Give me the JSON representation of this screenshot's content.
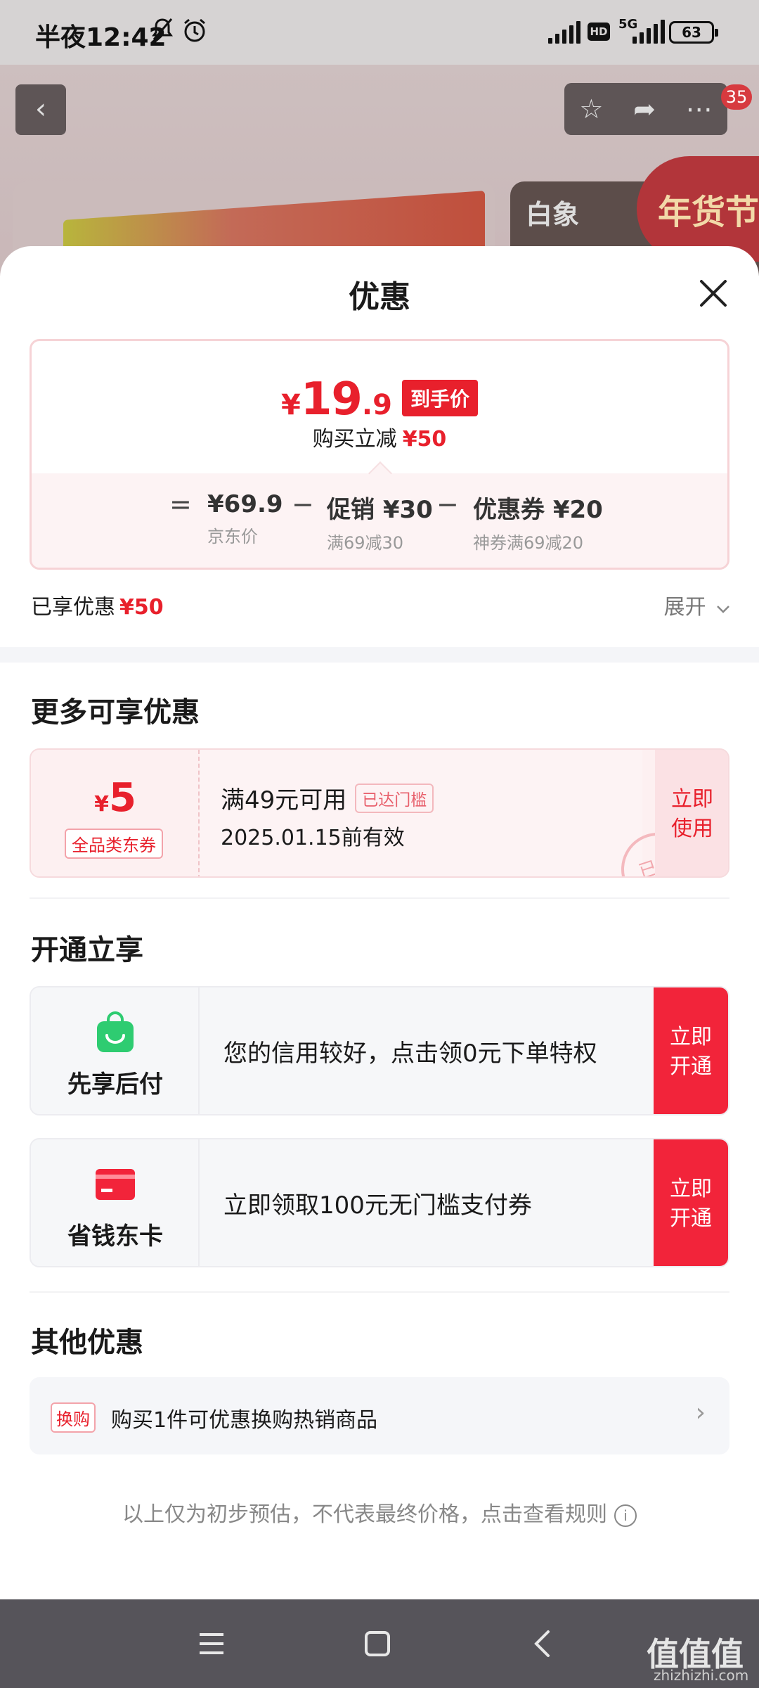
{
  "status_bar": {
    "time": "半夜12:42",
    "network": "5G",
    "hd": "HD",
    "battery": "63"
  },
  "background_page": {
    "cart_badge": "35",
    "brand_logo": "白象",
    "festival_label": "年货节"
  },
  "sheet": {
    "title": "优惠",
    "price": {
      "currency": "¥",
      "integer": "19",
      "decimal": ".9",
      "tag": "到手价",
      "reduce_label": "购买立减",
      "reduce_value": "¥50"
    },
    "breakdown": {
      "equals": "=",
      "items": [
        {
          "value": "¥69.9",
          "label": "京东价"
        },
        {
          "value": "促销 ¥30",
          "label": "满69减30"
        },
        {
          "value": "优惠券 ¥20",
          "label": "神券满69减20"
        }
      ],
      "minus": "−"
    },
    "enjoyed": {
      "label": "已享优惠",
      "value": "¥50"
    },
    "expand": "展开"
  },
  "more_offers": {
    "title": "更多可享优惠",
    "coupon": {
      "currency": "¥",
      "amount": "5",
      "type": "全品类东券",
      "condition": "满49元可用",
      "reached": "已达门槛",
      "expiry": "2025.01.15前有效",
      "stamp": "已领",
      "action": "立即使用"
    }
  },
  "open_section": {
    "title": "开通立享",
    "services": [
      {
        "name": "先享后付",
        "text": "您的信用较好，点击领0元下单特权",
        "action": "立即开通"
      },
      {
        "name": "省钱东卡",
        "text": "立即领取100元无门槛支付券",
        "action": "立即开通"
      }
    ]
  },
  "other_section": {
    "title": "其他优惠",
    "tag": "换购",
    "text": "购买1件可优惠换购热销商品",
    "arrow": "›"
  },
  "disclaimer": "以上仅为初步预估，不代表最终价格，点击查看规则",
  "watermark": {
    "main": "值值值",
    "sub": "zhizhizhi.com"
  },
  "colors": {
    "accent": "#e8202c",
    "button": "#f2243a",
    "coupon_bg": "#fdf0f1"
  }
}
